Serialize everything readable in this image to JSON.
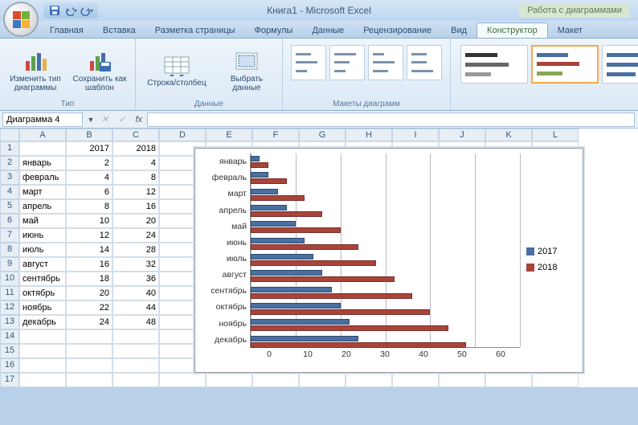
{
  "app": {
    "title": "Книга1 - Microsoft Excel",
    "context_label": "Работа с диаграммами"
  },
  "qat": {
    "tooltip_save": "save",
    "tooltip_undo": "undo",
    "tooltip_redo": "redo"
  },
  "tabs": {
    "items": [
      {
        "label": "Главная"
      },
      {
        "label": "Вставка"
      },
      {
        "label": "Разметка страницы"
      },
      {
        "label": "Формулы"
      },
      {
        "label": "Данные"
      },
      {
        "label": "Рецензирование"
      },
      {
        "label": "Вид"
      },
      {
        "label": "Конструктор",
        "active": true
      },
      {
        "label": "Макет"
      }
    ]
  },
  "ribbon": {
    "group_type_label": "Тип",
    "group_data_label": "Данные",
    "group_layouts_label": "Макеты диаграмм",
    "btn_change_type": "Изменить тип диаграммы",
    "btn_save_template": "Сохранить как шаблон",
    "btn_switch_rc": "Строка/столбец",
    "btn_select_data": "Выбрать данные"
  },
  "formula_bar": {
    "name_box_value": "Диаграмма 4",
    "fx_value": ""
  },
  "columns": [
    "A",
    "B",
    "C",
    "D",
    "E",
    "F",
    "G",
    "H",
    "I",
    "J",
    "K",
    "L"
  ],
  "rows": [
    1,
    2,
    3,
    4,
    5,
    6,
    7,
    8,
    9,
    10,
    11,
    12,
    13,
    14,
    15,
    16,
    17
  ],
  "table": {
    "header": {
      "b": "2017",
      "c": "2018"
    },
    "rows": [
      {
        "a": "январь",
        "b": 2,
        "c": 4
      },
      {
        "a": "февраль",
        "b": 4,
        "c": 8
      },
      {
        "a": "март",
        "b": 6,
        "c": 12
      },
      {
        "a": "апрель",
        "b": 8,
        "c": 16
      },
      {
        "a": "май",
        "b": 10,
        "c": 20
      },
      {
        "a": "июнь",
        "b": 12,
        "c": 24
      },
      {
        "a": "июль",
        "b": 14,
        "c": 28
      },
      {
        "a": "август",
        "b": 16,
        "c": 32
      },
      {
        "a": "сентябрь",
        "b": 18,
        "c": 36
      },
      {
        "a": "октябрь",
        "b": 20,
        "c": 40
      },
      {
        "a": "ноябрь",
        "b": 22,
        "c": 44
      },
      {
        "a": "декабрь",
        "b": 24,
        "c": 48
      }
    ]
  },
  "chart_data": {
    "type": "bar",
    "categories": [
      "январь",
      "февраль",
      "март",
      "апрель",
      "май",
      "июнь",
      "июль",
      "август",
      "сентябрь",
      "октябрь",
      "ноябрь",
      "декабрь"
    ],
    "series": [
      {
        "name": "2017",
        "values": [
          2,
          4,
          6,
          8,
          10,
          12,
          14,
          16,
          18,
          20,
          22,
          24
        ],
        "color": "#4a6fa1"
      },
      {
        "name": "2018",
        "values": [
          4,
          8,
          12,
          16,
          20,
          24,
          28,
          32,
          36,
          40,
          44,
          48
        ],
        "color": "#a9443b"
      }
    ],
    "xlim": [
      0,
      60
    ],
    "x_ticks": [
      0,
      10,
      20,
      30,
      40,
      50,
      60
    ],
    "legend_position": "right",
    "grid_vertical": true
  }
}
